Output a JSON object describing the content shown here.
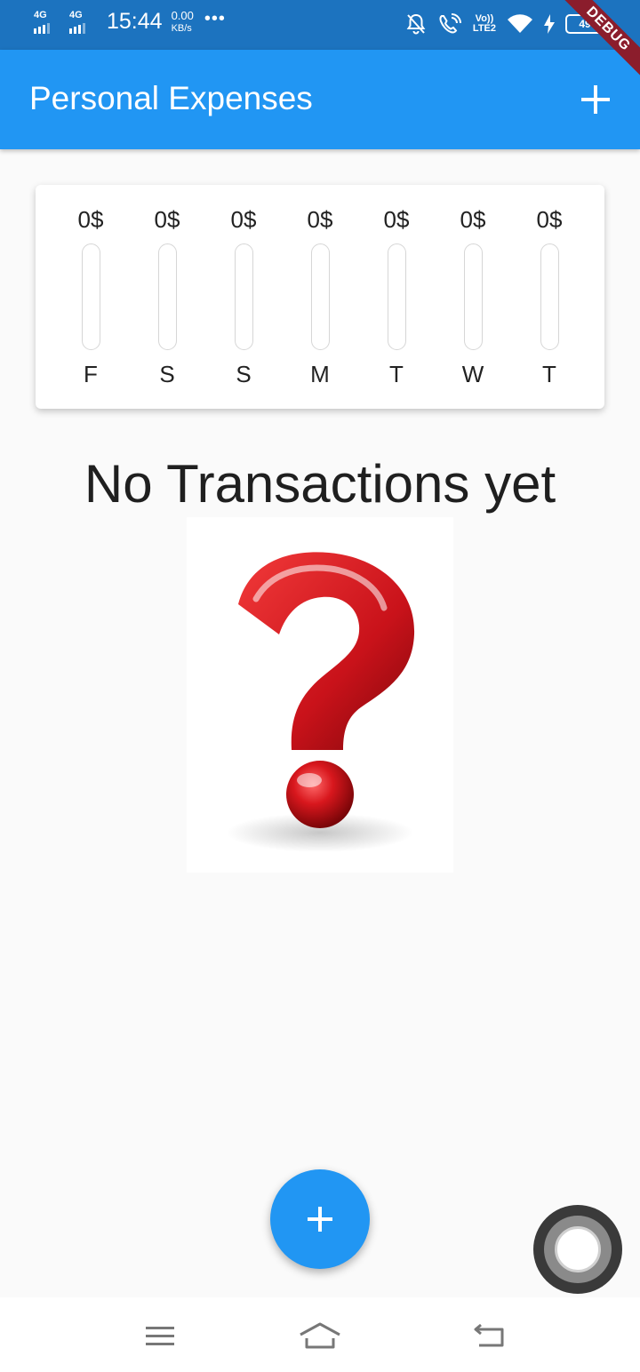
{
  "status_bar": {
    "sim1_network": "4G",
    "sim2_network": "4G",
    "time": "15:44",
    "speed_value": "0.00",
    "speed_unit": "KB/s",
    "more": "•••",
    "volte_top": "Vo))",
    "volte_bottom": "LTE2",
    "battery_level": "49",
    "debug_label": "DEBUG"
  },
  "app_bar": {
    "title": "Personal Expenses",
    "add_icon": "plus-icon"
  },
  "chart": {
    "bars": [
      {
        "day": "F",
        "amount": "0$",
        "fill": 0
      },
      {
        "day": "S",
        "amount": "0$",
        "fill": 0
      },
      {
        "day": "S",
        "amount": "0$",
        "fill": 0
      },
      {
        "day": "M",
        "amount": "0$",
        "fill": 0
      },
      {
        "day": "T",
        "amount": "0$",
        "fill": 0
      },
      {
        "day": "W",
        "amount": "0$",
        "fill": 0
      },
      {
        "day": "T",
        "amount": "0$",
        "fill": 0
      }
    ]
  },
  "empty_state": {
    "title": "No Transactions yet",
    "image_icon": "question-mark-image"
  },
  "fab": {
    "icon": "plus-icon"
  },
  "colors": {
    "primary": "#2196f3",
    "status_bar": "#1c73bf",
    "question_red": "#d8171d"
  }
}
